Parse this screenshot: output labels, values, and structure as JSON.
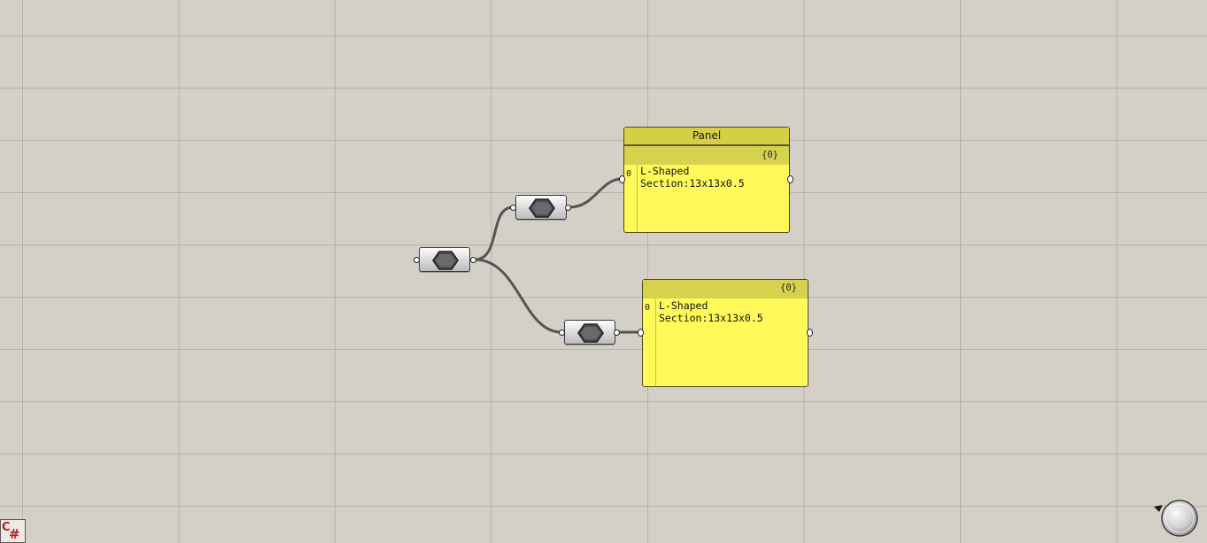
{
  "panel_top": {
    "title": "Panel",
    "path": "{0}",
    "index": "0",
    "content": "L-Shaped\nSection:13x13x0.5"
  },
  "panel_bottom": {
    "path": "{0}",
    "index": "0",
    "content": "L-Shaped\nSection:13x13x0.5"
  },
  "icons": {
    "relay": "hexagon-relay-icon",
    "script": "csharp-script-icon",
    "navigation": "navigation-compass-icon"
  },
  "csharp_icon": {
    "c": "C",
    "hash": "#"
  },
  "colors": {
    "canvas": "#d4d0c8",
    "panel_fill": "#fff95a",
    "panel_header": "#d4cf44",
    "wire": "#555555"
  }
}
